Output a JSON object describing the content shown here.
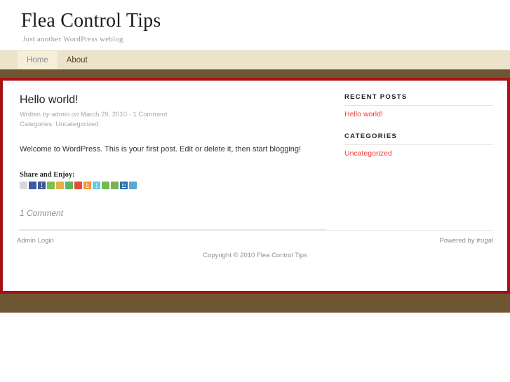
{
  "header": {
    "site_title": "Flea Control Tips",
    "tagline": "Just another WordPress weblog"
  },
  "nav": {
    "items": [
      {
        "label": "Home",
        "current": true
      },
      {
        "label": "About",
        "current": false
      }
    ]
  },
  "post": {
    "title": "Hello world!",
    "meta_written": "Written",
    "meta_by": "by",
    "meta_author": "admin",
    "meta_on": "on",
    "meta_date": "March 29, 2010",
    "meta_separator": "·",
    "meta_comments": "1 Comment",
    "meta_categories_label": "Categories:",
    "meta_categories_value": "Uncategorized",
    "body": "Welcome to WordPress. This is your first post. Edit or delete it, then start blogging!",
    "share_heading": "Share and Enjoy:",
    "share_icons": [
      {
        "name": "friendfeed-icon",
        "color": "#d9d9d9",
        "glyph": ""
      },
      {
        "name": "delicious-icon",
        "color": "#3b5ba5",
        "glyph": ""
      },
      {
        "name": "facebook-icon",
        "color": "#3b5998",
        "glyph": "f"
      },
      {
        "name": "evernote-icon",
        "color": "#7fc04c",
        "glyph": ""
      },
      {
        "name": "mixx-icon",
        "color": "#e8ae4b",
        "glyph": ""
      },
      {
        "name": "stumbleupon-icon",
        "color": "#5bb75b",
        "glyph": ""
      },
      {
        "name": "google-buzz-icon",
        "color": "#e34b3c",
        "glyph": ""
      },
      {
        "name": "blogger-icon",
        "color": "#f29434",
        "glyph": "b"
      },
      {
        "name": "twitter-icon",
        "color": "#6fc4e8",
        "glyph": "t"
      },
      {
        "name": "technorati-icon",
        "color": "#6cc04a",
        "glyph": ""
      },
      {
        "name": "newsvine-icon",
        "color": "#7fae5a",
        "glyph": ""
      },
      {
        "name": "linkedin-icon",
        "color": "#2a6fa8",
        "glyph": "in"
      },
      {
        "name": "ms-live-icon",
        "color": "#5aa6d8",
        "glyph": ""
      }
    ],
    "comments_count": "1 Comment"
  },
  "sidebar": {
    "widgets": [
      {
        "title": "RECENT POSTS",
        "links": [
          "Hello world!"
        ]
      },
      {
        "title": "CATEGORIES",
        "links": [
          "Uncategorized"
        ]
      }
    ]
  },
  "footer": {
    "admin_login": "Admin Login",
    "powered_prefix": "Powered by ",
    "powered_name": "frugal",
    "copyright": "Copyright © 2010 Flea Control Tips"
  },
  "colors": {
    "frame_border": "#a61113",
    "brown_band": "#6f5632",
    "nav_background": "#ece3cb",
    "nav_active": "#f5eed9",
    "link_red": "#e8413f"
  }
}
